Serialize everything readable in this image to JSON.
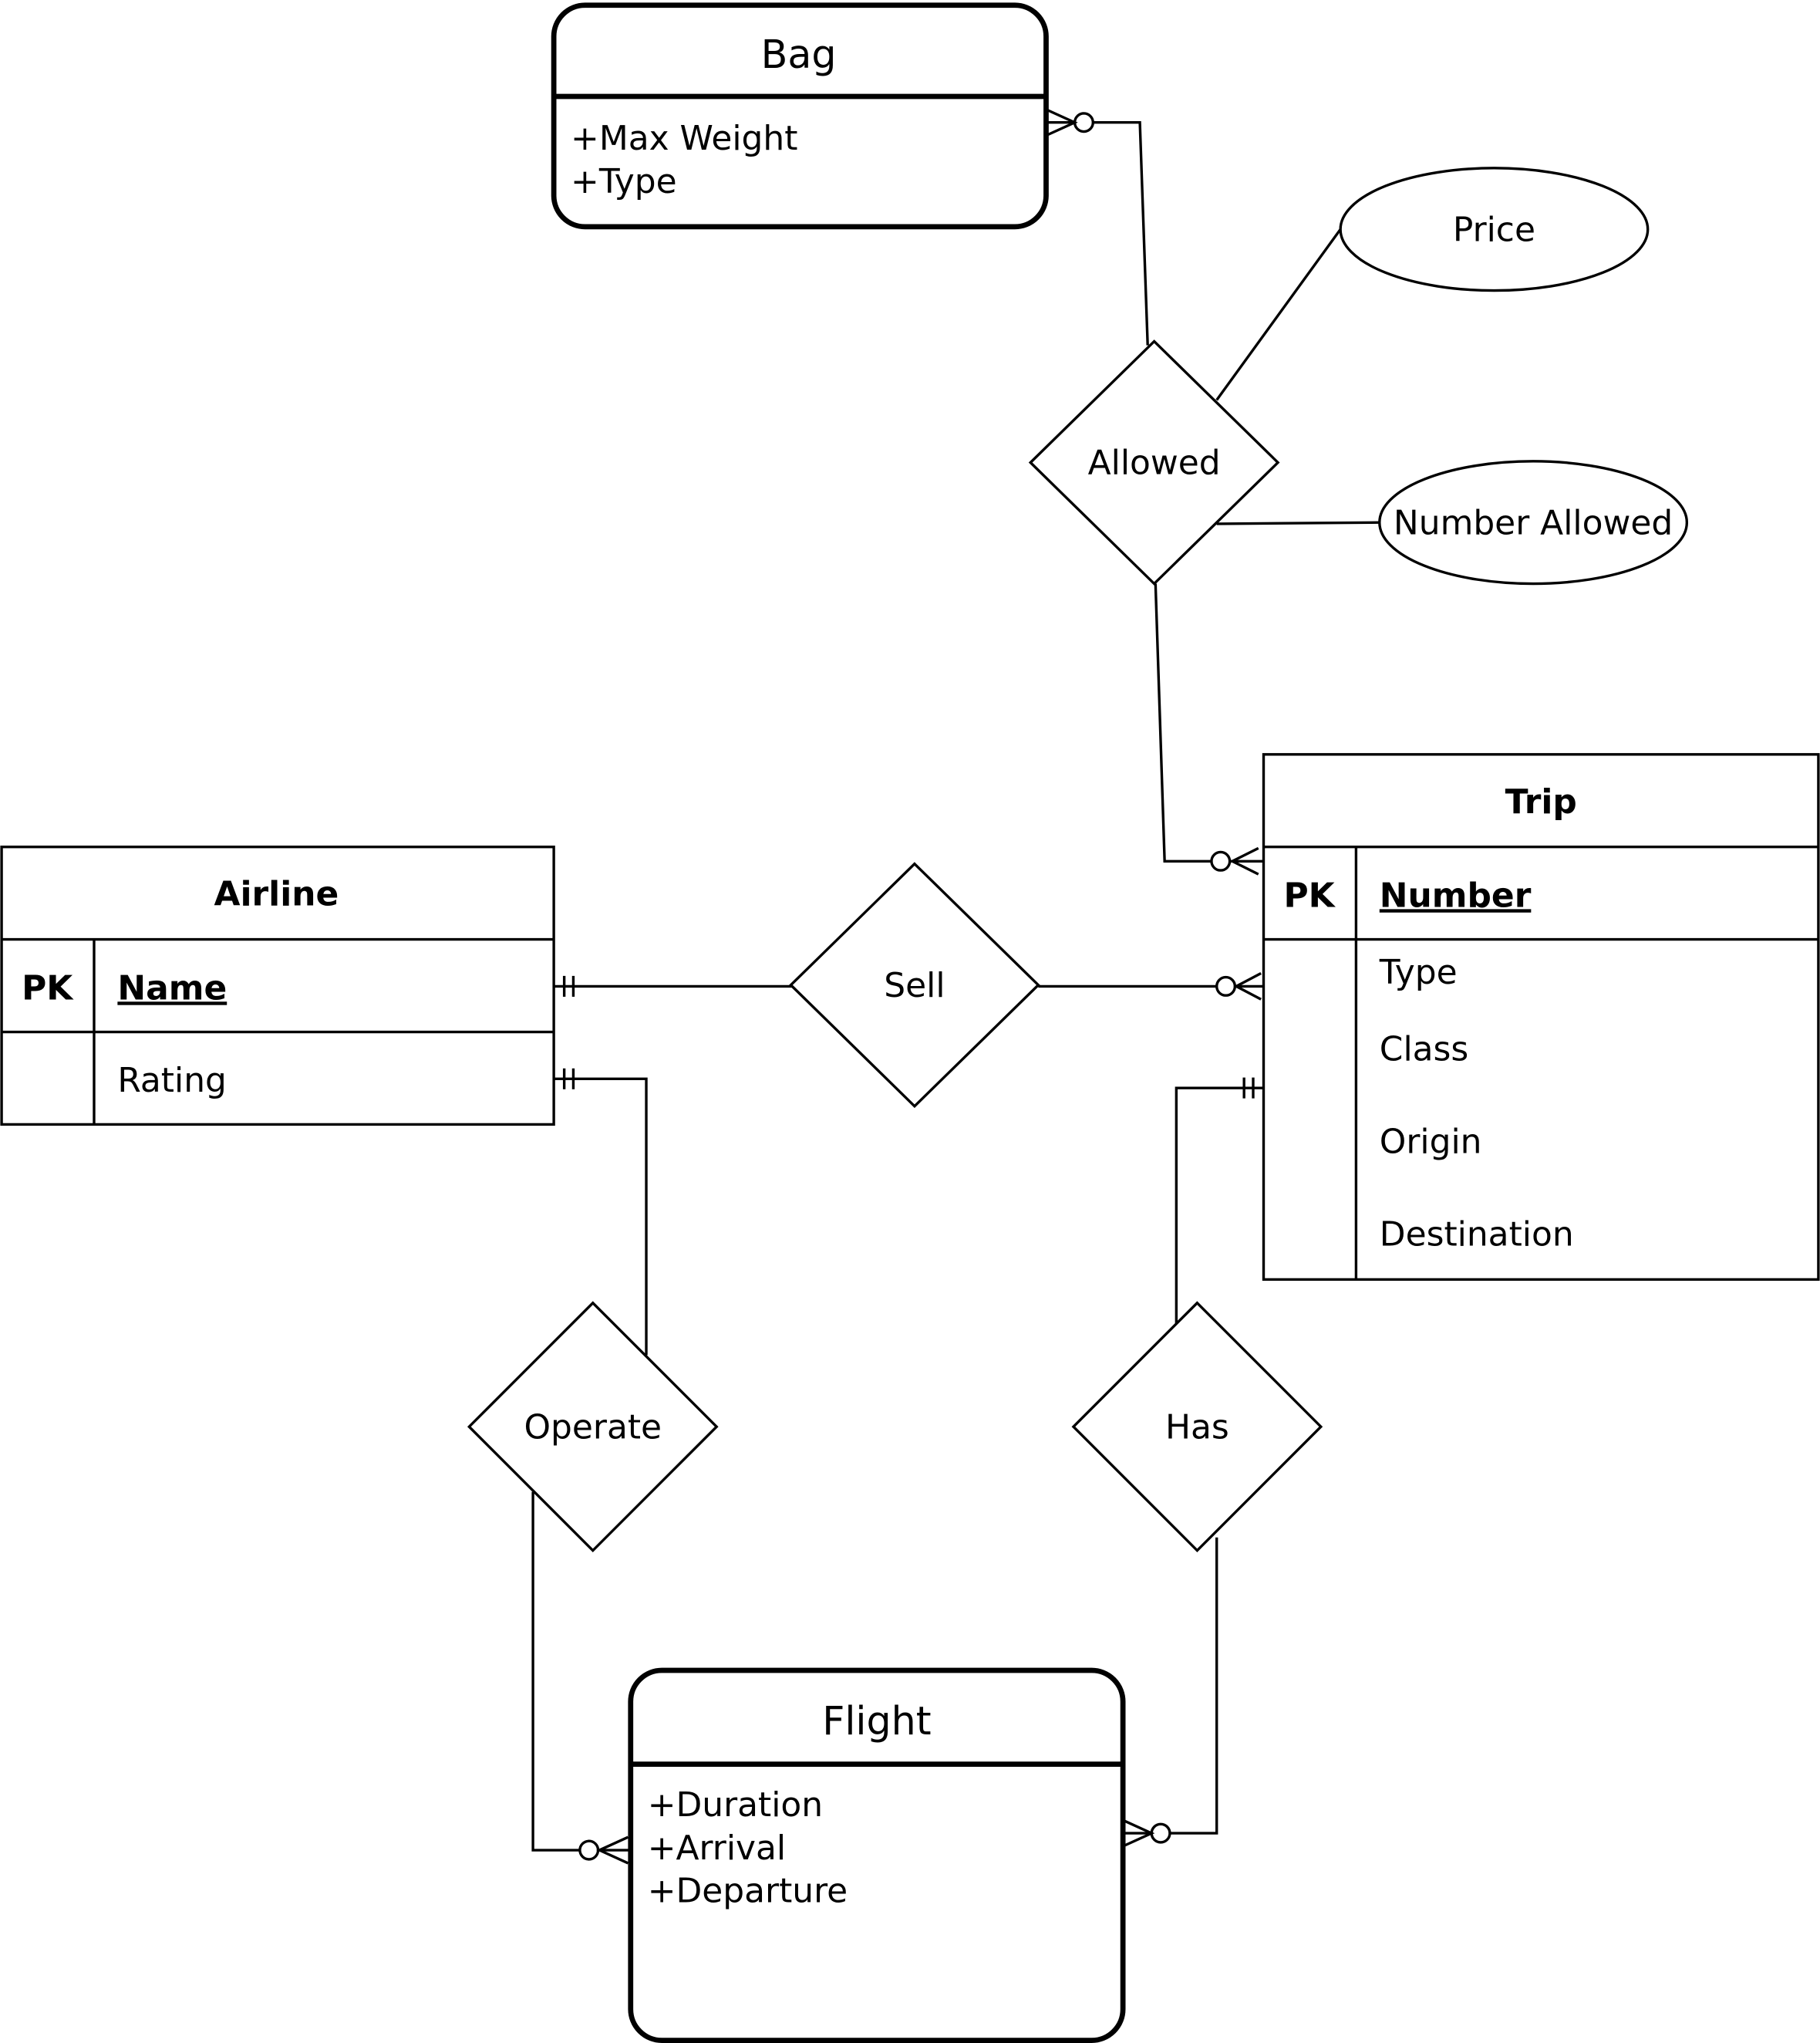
{
  "entities": {
    "bag": {
      "title": "Bag",
      "attributes": [
        "+Max Weight",
        "+Type"
      ]
    },
    "flight": {
      "title": "Flight",
      "attributes": [
        "+Duration",
        "+Arrival",
        "+Departure"
      ]
    },
    "trip": {
      "title": "Trip",
      "pk_label": "PK",
      "pk_field": "Number",
      "fields": [
        "Type",
        "Class",
        "Origin",
        "Destination"
      ]
    },
    "airline": {
      "title": "Airline",
      "pk_label": "PK",
      "pk_field": "Name",
      "fields": [
        "Rating"
      ]
    }
  },
  "relationships": {
    "allowed": "Allowed",
    "sell": "Sell",
    "operate": "Operate",
    "has": "Has"
  },
  "attributes": {
    "price": "Price",
    "number_allowed": "Number Allowed"
  }
}
